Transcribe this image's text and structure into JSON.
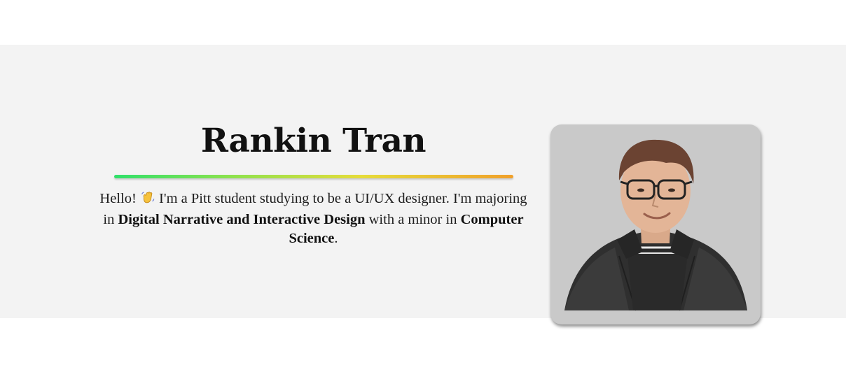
{
  "profile": {
    "name": "Rankin Tran",
    "bio_part1": "Hello! ",
    "bio_emoji": "waving-hand-icon",
    "bio_part2": " I'm a Pitt student studying to be a UI/UX designer. I'm majoring in ",
    "major": "Digital Narrative and Interactive Design",
    "bio_part3": " with a minor in ",
    "minor": "Computer Science",
    "bio_part4": "."
  },
  "colors": {
    "hero_background": "#f3f3f3",
    "page_background": "#ffffff",
    "photo_background": "#c9c9c9",
    "rule_gradient": [
      "#2fe06a",
      "#8fe24d",
      "#e6dc3a",
      "#f0a02a"
    ]
  }
}
